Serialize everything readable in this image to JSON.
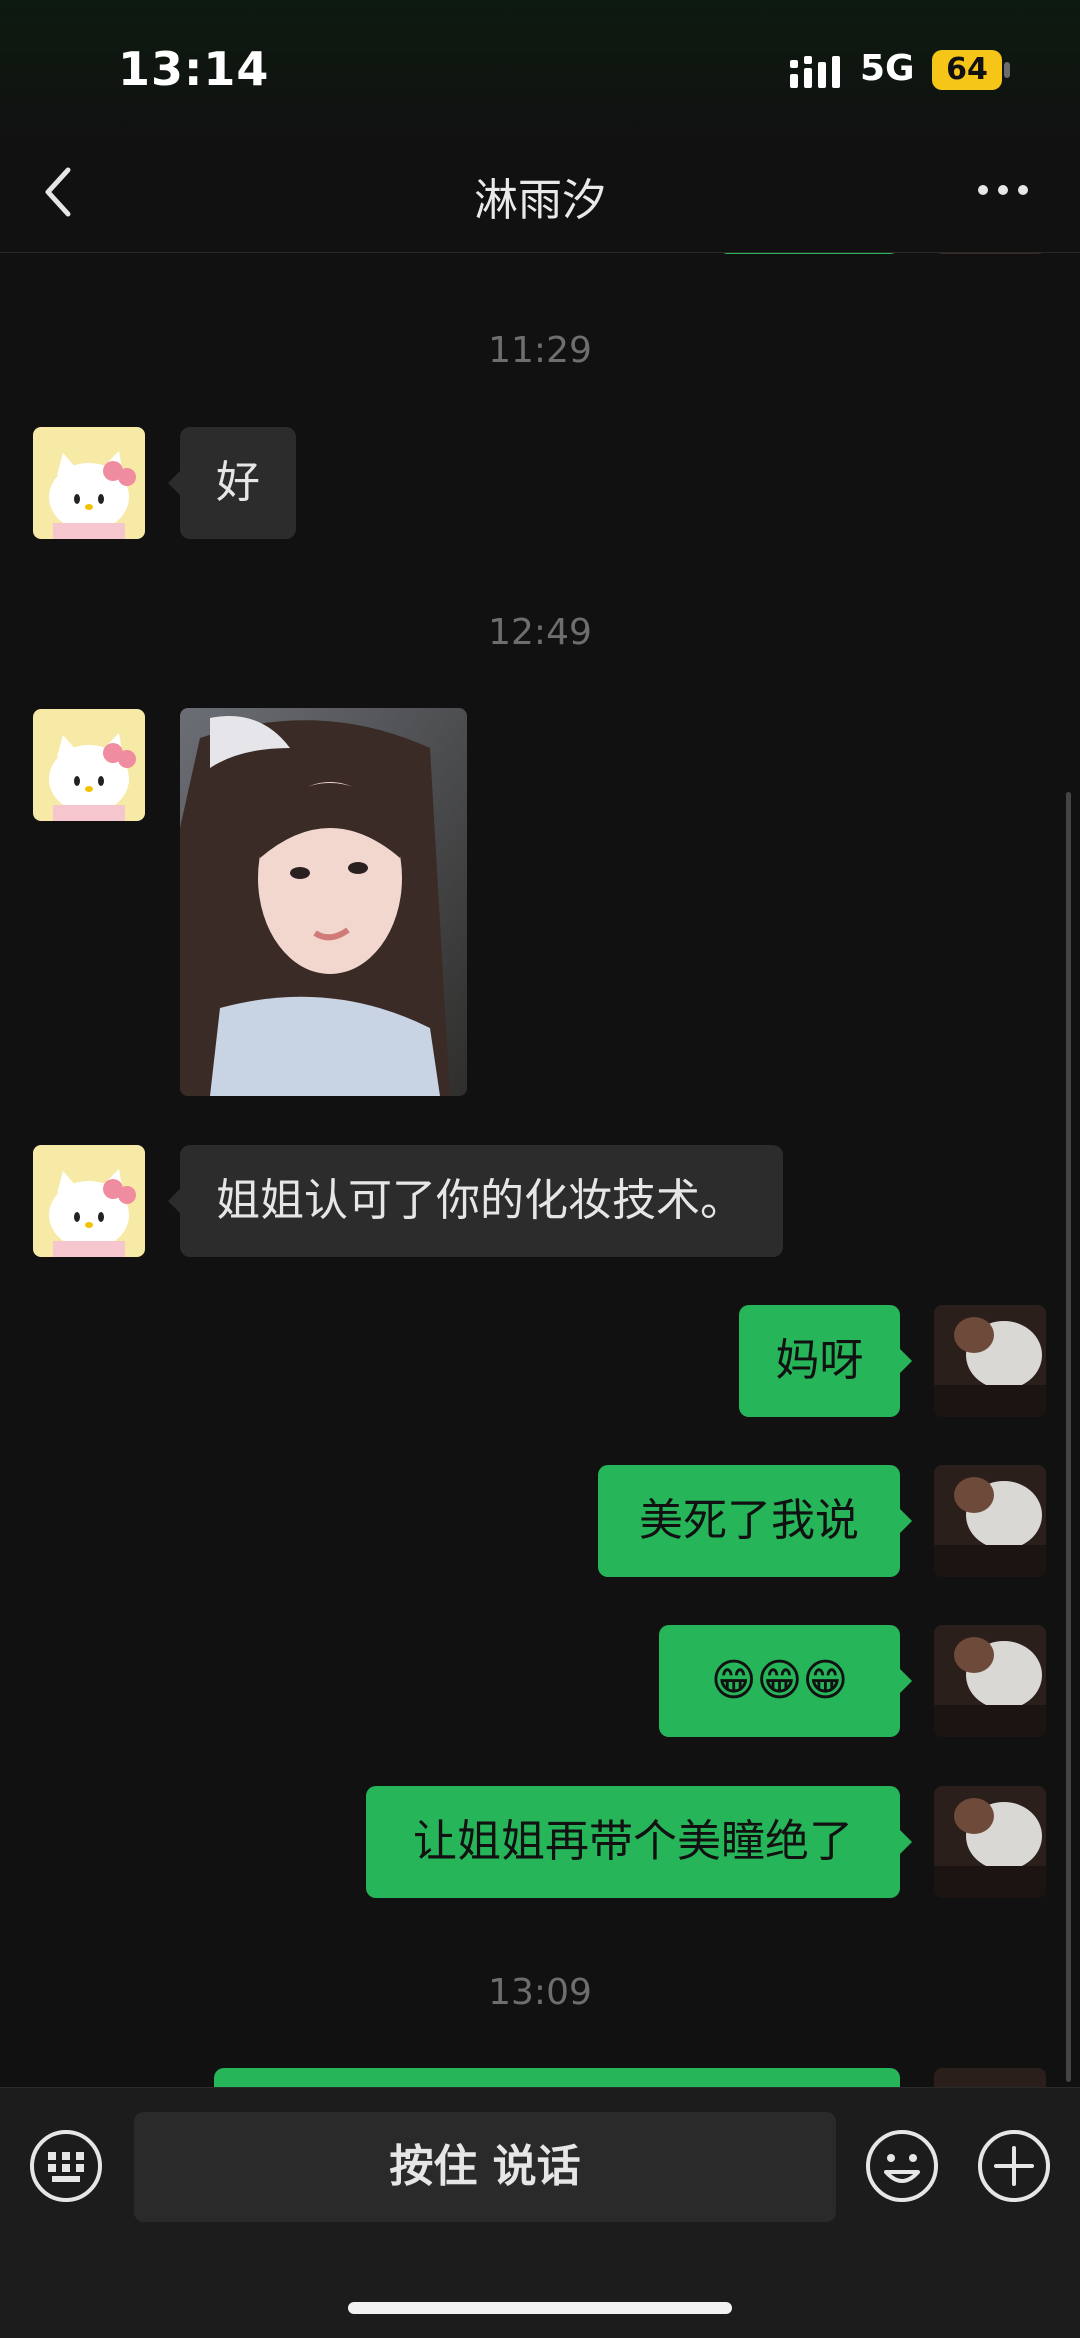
{
  "status": {
    "time": "13:14",
    "network": "5G",
    "battery": "64"
  },
  "nav": {
    "title": "淋雨汐"
  },
  "messages": {
    "ts1": "11:29",
    "m1": "好",
    "ts2": "12:49",
    "m3": "姐姐认可了你的化妆技术。",
    "m4": "妈呀",
    "m5": "美死了我说",
    "m6": "😁😁😁",
    "m7": "让姐姐再带个美瞳绝了",
    "ts3": "13:09"
  },
  "input": {
    "talk_label": "按住 说话"
  },
  "colors": {
    "sent_bubble": "#27b55a",
    "received_bubble": "#2c2c2c",
    "battery": "#f5c518"
  }
}
